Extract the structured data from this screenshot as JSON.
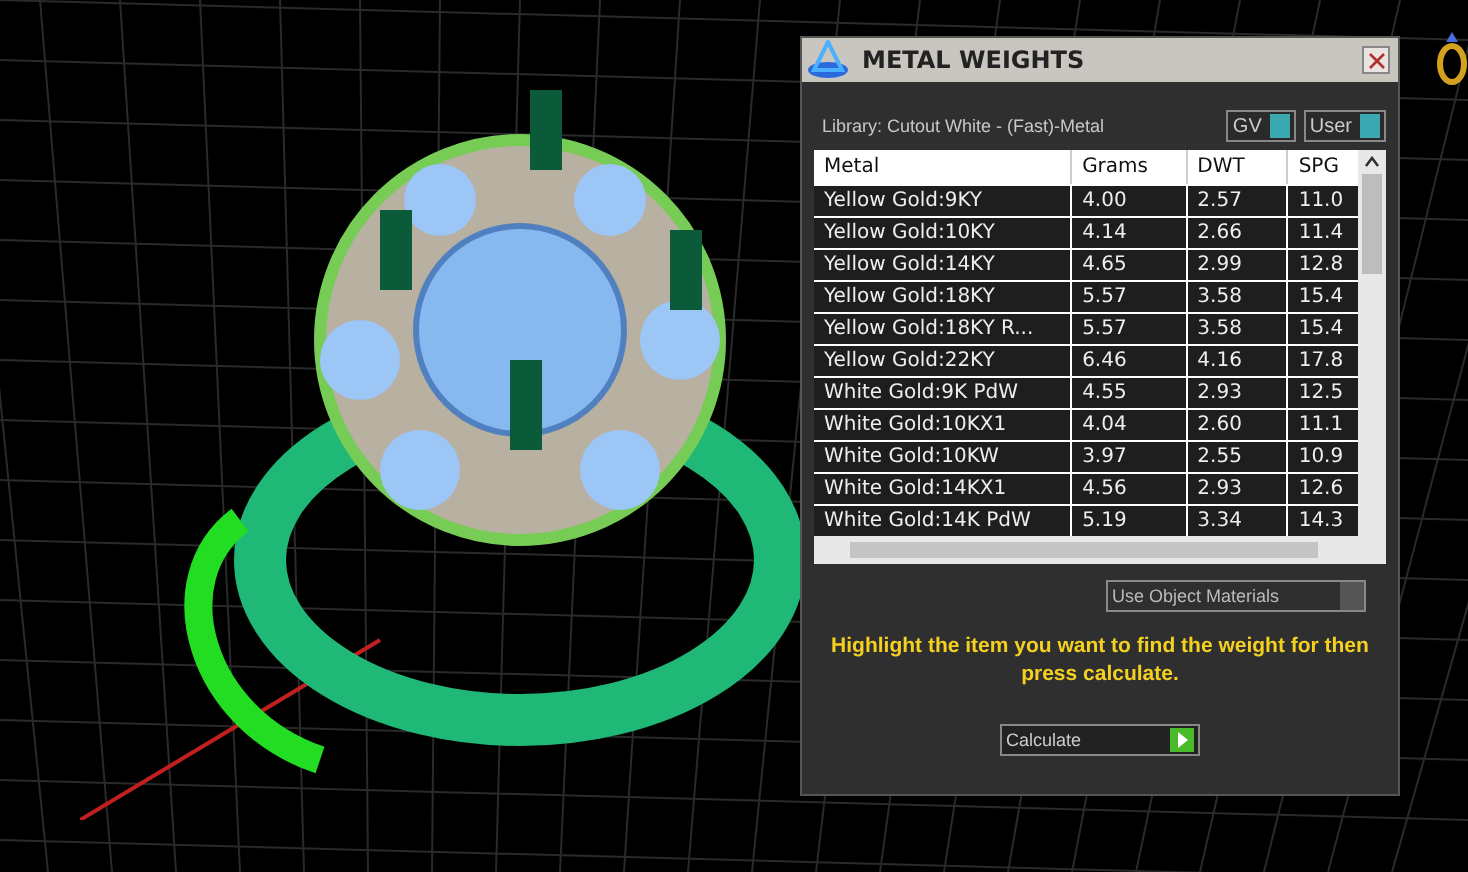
{
  "window": {
    "title": "METAL WEIGHTS"
  },
  "library": "Library: Cutout White - (Fast)-Metal",
  "toggles": [
    {
      "label": "GV",
      "on": true
    },
    {
      "label": "User",
      "on": true
    }
  ],
  "table": {
    "columns": [
      "Metal",
      "Grams",
      "DWT",
      "SPG"
    ],
    "rows": [
      [
        "Yellow Gold:9KY",
        "4.00",
        "2.57",
        "11.0"
      ],
      [
        "Yellow Gold:10KY",
        "4.14",
        "2.66",
        "11.4"
      ],
      [
        "Yellow Gold:14KY",
        "4.65",
        "2.99",
        "12.8"
      ],
      [
        "Yellow Gold:18KY",
        "5.57",
        "3.58",
        "15.4"
      ],
      [
        "Yellow Gold:18KY R...",
        "5.57",
        "3.58",
        "15.4"
      ],
      [
        "Yellow Gold:22KY",
        "6.46",
        "4.16",
        "17.8"
      ],
      [
        "White Gold:9K PdW",
        "4.55",
        "2.93",
        "12.5"
      ],
      [
        "White Gold:10KX1",
        "4.04",
        "2.60",
        "11.1"
      ],
      [
        "White Gold:10KW",
        "3.97",
        "2.55",
        "10.9"
      ],
      [
        "White Gold:14KX1",
        "4.56",
        "2.93",
        "12.6"
      ],
      [
        "White Gold:14K PdW",
        "5.19",
        "3.34",
        "14.3"
      ]
    ]
  },
  "use_object_materials": {
    "label": "Use Object Materials",
    "checked": false
  },
  "message": "Highlight the item you want to find the weight for then press calculate.",
  "calculate_button": "Calculate"
}
